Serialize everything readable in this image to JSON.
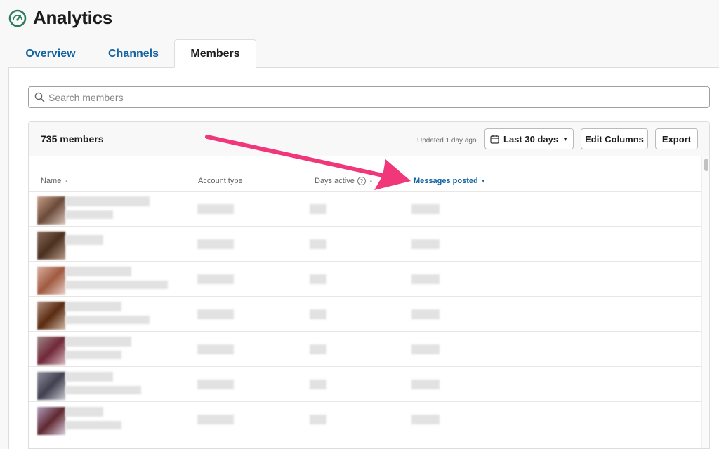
{
  "header": {
    "title": "Analytics",
    "icon": "speedometer-icon"
  },
  "tabs": [
    {
      "label": "Overview",
      "active": false
    },
    {
      "label": "Channels",
      "active": false
    },
    {
      "label": "Members",
      "active": true
    }
  ],
  "search": {
    "placeholder": "Search members",
    "value": ""
  },
  "toolbar": {
    "member_count": "735 members",
    "updated": "Updated 1 day ago",
    "range_label": "Last 30 days",
    "edit_columns_label": "Edit Columns",
    "export_label": "Export"
  },
  "table": {
    "columns": [
      {
        "label": "Name",
        "sort": "asc"
      },
      {
        "label": "Account type",
        "sort": "none"
      },
      {
        "label": "Days active",
        "sort": "asc"
      },
      {
        "label": "Messages posted",
        "sort": "desc"
      }
    ]
  },
  "colors": {
    "accent": "#1264a3",
    "annotation_arrow": "#f0377a",
    "brand_green": "#2a7d5c"
  }
}
